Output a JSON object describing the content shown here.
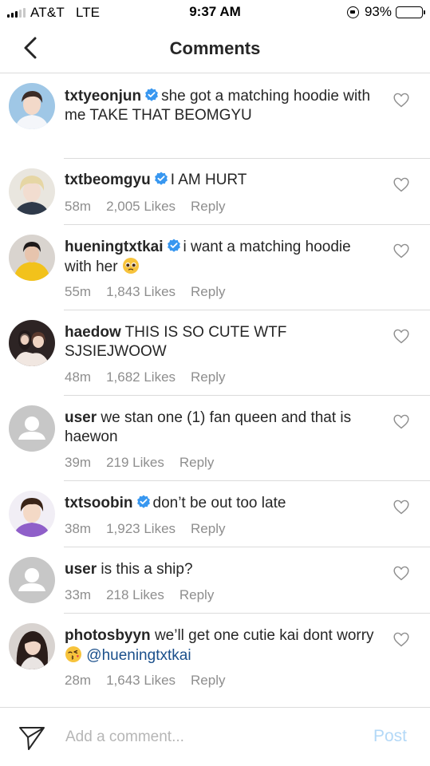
{
  "status_bar": {
    "carrier": "AT&T",
    "network": "LTE",
    "time": "9:37 AM",
    "battery": "93%",
    "battery_level": 0.93,
    "signal_bars_active": 3,
    "signal_bars_total": 5
  },
  "header": {
    "title": "Comments",
    "back_icon": "chevron-left-icon"
  },
  "comments": [
    {
      "username": "txtyeonjun",
      "verified": true,
      "text": "she got a matching hoodie with me TAKE THAT BEOMGYU",
      "time": "",
      "likes": "",
      "reply": ""
    },
    {
      "username": "txtbeomgyu",
      "verified": true,
      "text": "I AM HURT",
      "time": "58m",
      "likes": "2,005 Likes",
      "reply": "Reply"
    },
    {
      "username": "hueningtxtkai",
      "verified": true,
      "text": "i want a matching hoodie with her",
      "emoji": "pleading-face-emoji",
      "time": "55m",
      "likes": "1,843 Likes",
      "reply": "Reply"
    },
    {
      "username": "haedow",
      "verified": false,
      "text": "THIS IS SO CUTE WTF SJSIEJWOOW",
      "time": "48m",
      "likes": "1,682 Likes",
      "reply": "Reply"
    },
    {
      "username": "user",
      "verified": false,
      "text": "we stan one (1) fan queen and that is haewon",
      "time": "39m",
      "likes": "219 Likes",
      "reply": "Reply"
    },
    {
      "username": "txtsoobin",
      "verified": true,
      "text": "don’t be out too late",
      "time": "38m",
      "likes": "1,923 Likes",
      "reply": "Reply"
    },
    {
      "username": "user",
      "verified": false,
      "text": "is this a ship?",
      "time": "33m",
      "likes": "218 Likes",
      "reply": "Reply"
    },
    {
      "username": "photosbyyn",
      "verified": false,
      "text": "we’ll get one cutie kai dont worry",
      "emoji": "kissing-heart-emoji",
      "mention": "@hueningtxtkai",
      "time": "28m",
      "likes": "1,643 Likes",
      "reply": "Reply"
    }
  ],
  "input_bar": {
    "placeholder": "Add a comment...",
    "post_label": "Post",
    "send_icon": "direct-send-icon"
  },
  "colors": {
    "text": "#262626",
    "meta": "#8e8e8e",
    "verified": "#3897f0",
    "mention": "#1a4f8b",
    "post_disabled": "#b3d8f7",
    "separator": "#dbdbdb"
  }
}
